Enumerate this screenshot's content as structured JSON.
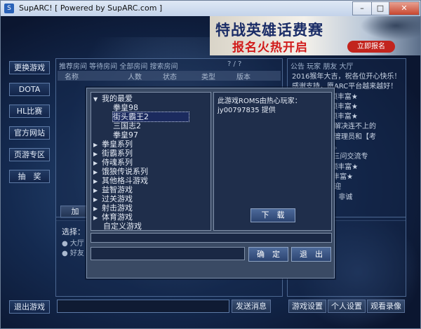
{
  "window": {
    "title": "SupARC!  [ Powered by SupARC.com ]"
  },
  "window_controls": {
    "minimize": "–",
    "maximize": "□",
    "close": "✕"
  },
  "banner": {
    "line1": "特战英雄话费赛",
    "line2": "报名火热开启",
    "button": "立即报名"
  },
  "left_nav": [
    "更换游戏",
    "DOTA",
    "HL比赛",
    "官方网站",
    "页游专区",
    "抽　奖"
  ],
  "exit_button": "退出游戏",
  "room_panel": {
    "tabs": "推荐房间  等待房间  全部房间  搜索房间",
    "help": "? / ?",
    "columns": [
      "名称",
      "人数",
      "状态",
      "类型",
      "版本"
    ],
    "join_button": "加"
  },
  "news_panel": {
    "header": "公告  玩家  朋友  大厅",
    "lines": [
      "2016猴年大吉，祝各位开心快乐！",
      "感谢支持，愿ARC平台越来越好！",
      "★8  2千人名额丰富★",
      "★8  2千人名额丰富★",
      "★9  2千人名额丰富★",
      "反馈问题，有解决连不上的",
      "问题请招纷力管理员和【考",
      "式测我的请加。",
      "1/1，KOF98三问交流专",
      "★4一千人名额丰富★",
      "661289名额丰富★",
      "约比赛大厅欢迎",
      "1群联系群主，非诚"
    ]
  },
  "chat_panel": {
    "select_label": "选择：",
    "options": [
      "大厅",
      "好友"
    ]
  },
  "send_button": "发送消息",
  "bottom_buttons": [
    "游戏设置",
    "个人设置",
    "观看录像"
  ],
  "dialog": {
    "tree": [
      {
        "label": "我的最爱",
        "expanded": true,
        "level": 0
      },
      {
        "label": "拳皇98",
        "level": 1
      },
      {
        "label": "街头霸王2",
        "level": 1,
        "selected": true
      },
      {
        "label": "三国志2",
        "level": 1
      },
      {
        "label": "拳皇97",
        "level": 1
      },
      {
        "label": "拳皇系列",
        "level": 0,
        "expanded": false
      },
      {
        "label": "街霸系列",
        "level": 0,
        "expanded": false
      },
      {
        "label": "侍魂系列",
        "level": 0,
        "expanded": false
      },
      {
        "label": "饿狼传说系列",
        "level": 0,
        "expanded": false
      },
      {
        "label": "其他格斗游戏",
        "level": 0,
        "expanded": false
      },
      {
        "label": "益智游戏",
        "level": 0,
        "expanded": false
      },
      {
        "label": "过关游戏",
        "level": 0,
        "expanded": false
      },
      {
        "label": "射击游戏",
        "level": 0,
        "expanded": false
      },
      {
        "label": "体育游戏",
        "level": 0,
        "expanded": false
      },
      {
        "label": "自定义游戏",
        "level": 0
      }
    ],
    "info_text": "此游戏ROMS由热心玩家：jy00797835 提供",
    "download_button": "下　载",
    "ok_button": "确　定",
    "exit_button": "退　出"
  },
  "colors": {
    "accent": "#2c4471",
    "background": "#0f1e3a",
    "banner_red": "#c2241d"
  }
}
